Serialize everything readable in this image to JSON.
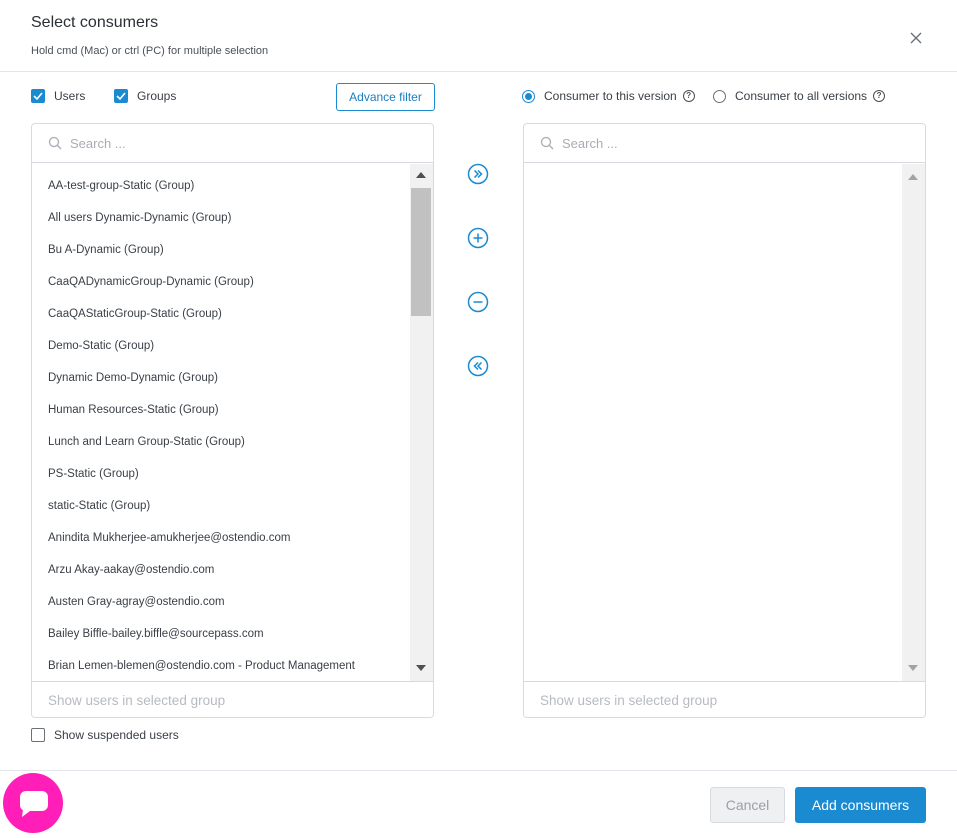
{
  "header": {
    "title": "Select consumers",
    "subtitle": "Hold cmd (Mac) or ctrl (PC) for multiple selection",
    "close_icon": "close-icon"
  },
  "filters": {
    "users_label": "Users",
    "users_checked": true,
    "groups_label": "Groups",
    "groups_checked": true,
    "advance_filter_label": "Advance filter"
  },
  "scope": {
    "this_version_label": "Consumer to this version",
    "this_version_selected": true,
    "all_versions_label": "Consumer to all versions",
    "all_versions_selected": false,
    "help_icon": "help-circle-icon"
  },
  "left_panel": {
    "search_placeholder": "Search ...",
    "items": [
      "AA-test-group-Static (Group)",
      "All users Dynamic-Dynamic (Group)",
      "Bu A-Dynamic (Group)",
      "CaaQADynamicGroup-Dynamic (Group)",
      "CaaQAStaticGroup-Static (Group)",
      "Demo-Static (Group)",
      "Dynamic Demo-Dynamic (Group)",
      "Human Resources-Static (Group)",
      "Lunch and Learn Group-Static (Group)",
      "PS-Static (Group)",
      "static-Static (Group)",
      "Anindita Mukherjee-amukherjee@ostendio.com",
      "Arzu Akay-aakay@ostendio.com",
      "Austen Gray-agray@ostendio.com",
      "Bailey Biffle-bailey.biffle@sourcepass.com",
      "Brian Lemen-blemen@ostendio.com - Product Management"
    ],
    "footer_text": "Show users in selected group"
  },
  "right_panel": {
    "search_placeholder": "Search ...",
    "items": [],
    "footer_text": "Show users in selected group"
  },
  "transfer_buttons": {
    "add_all_icon": "double-chevron-right-icon",
    "add_icon": "plus-circle-icon",
    "remove_icon": "minus-circle-icon",
    "remove_all_icon": "double-chevron-left-icon"
  },
  "suspended": {
    "label": "Show suspended users",
    "checked": false
  },
  "actions": {
    "cancel_label": "Cancel",
    "add_label": "Add consumers"
  },
  "colors": {
    "accent": "#1a8ad1",
    "chat_bubble": "#ff1fb8"
  }
}
